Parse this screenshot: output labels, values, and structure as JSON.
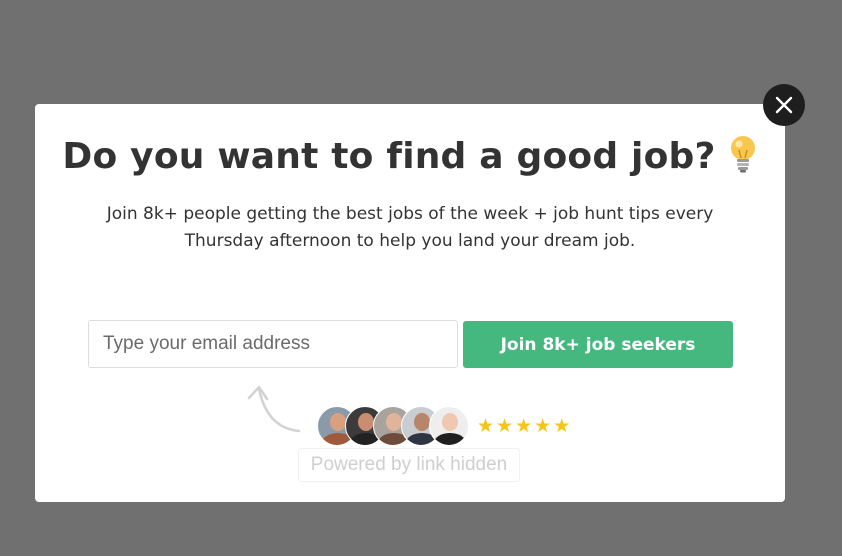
{
  "modal": {
    "headline": "Do you want to find a good job?",
    "headline_icon": "lightbulb-icon",
    "subtext": "Join 8k+ people getting the best jobs of the week + job hunt tips every Thursday afternoon to help you land your dream job.",
    "email_placeholder": "Type your email address",
    "email_value": "",
    "submit_label": "Join 8k+ job seekers",
    "rating_stars": 5,
    "star_glyph": "★",
    "avatar_count": 5,
    "powered_by": "Powered by link hidden"
  },
  "close": {
    "icon": "close-icon"
  },
  "colors": {
    "overlay": "#707070",
    "accent_green": "#45b880",
    "star_gold": "#f5c518",
    "text_dark": "#333333",
    "close_bg": "#1e1e1e"
  }
}
